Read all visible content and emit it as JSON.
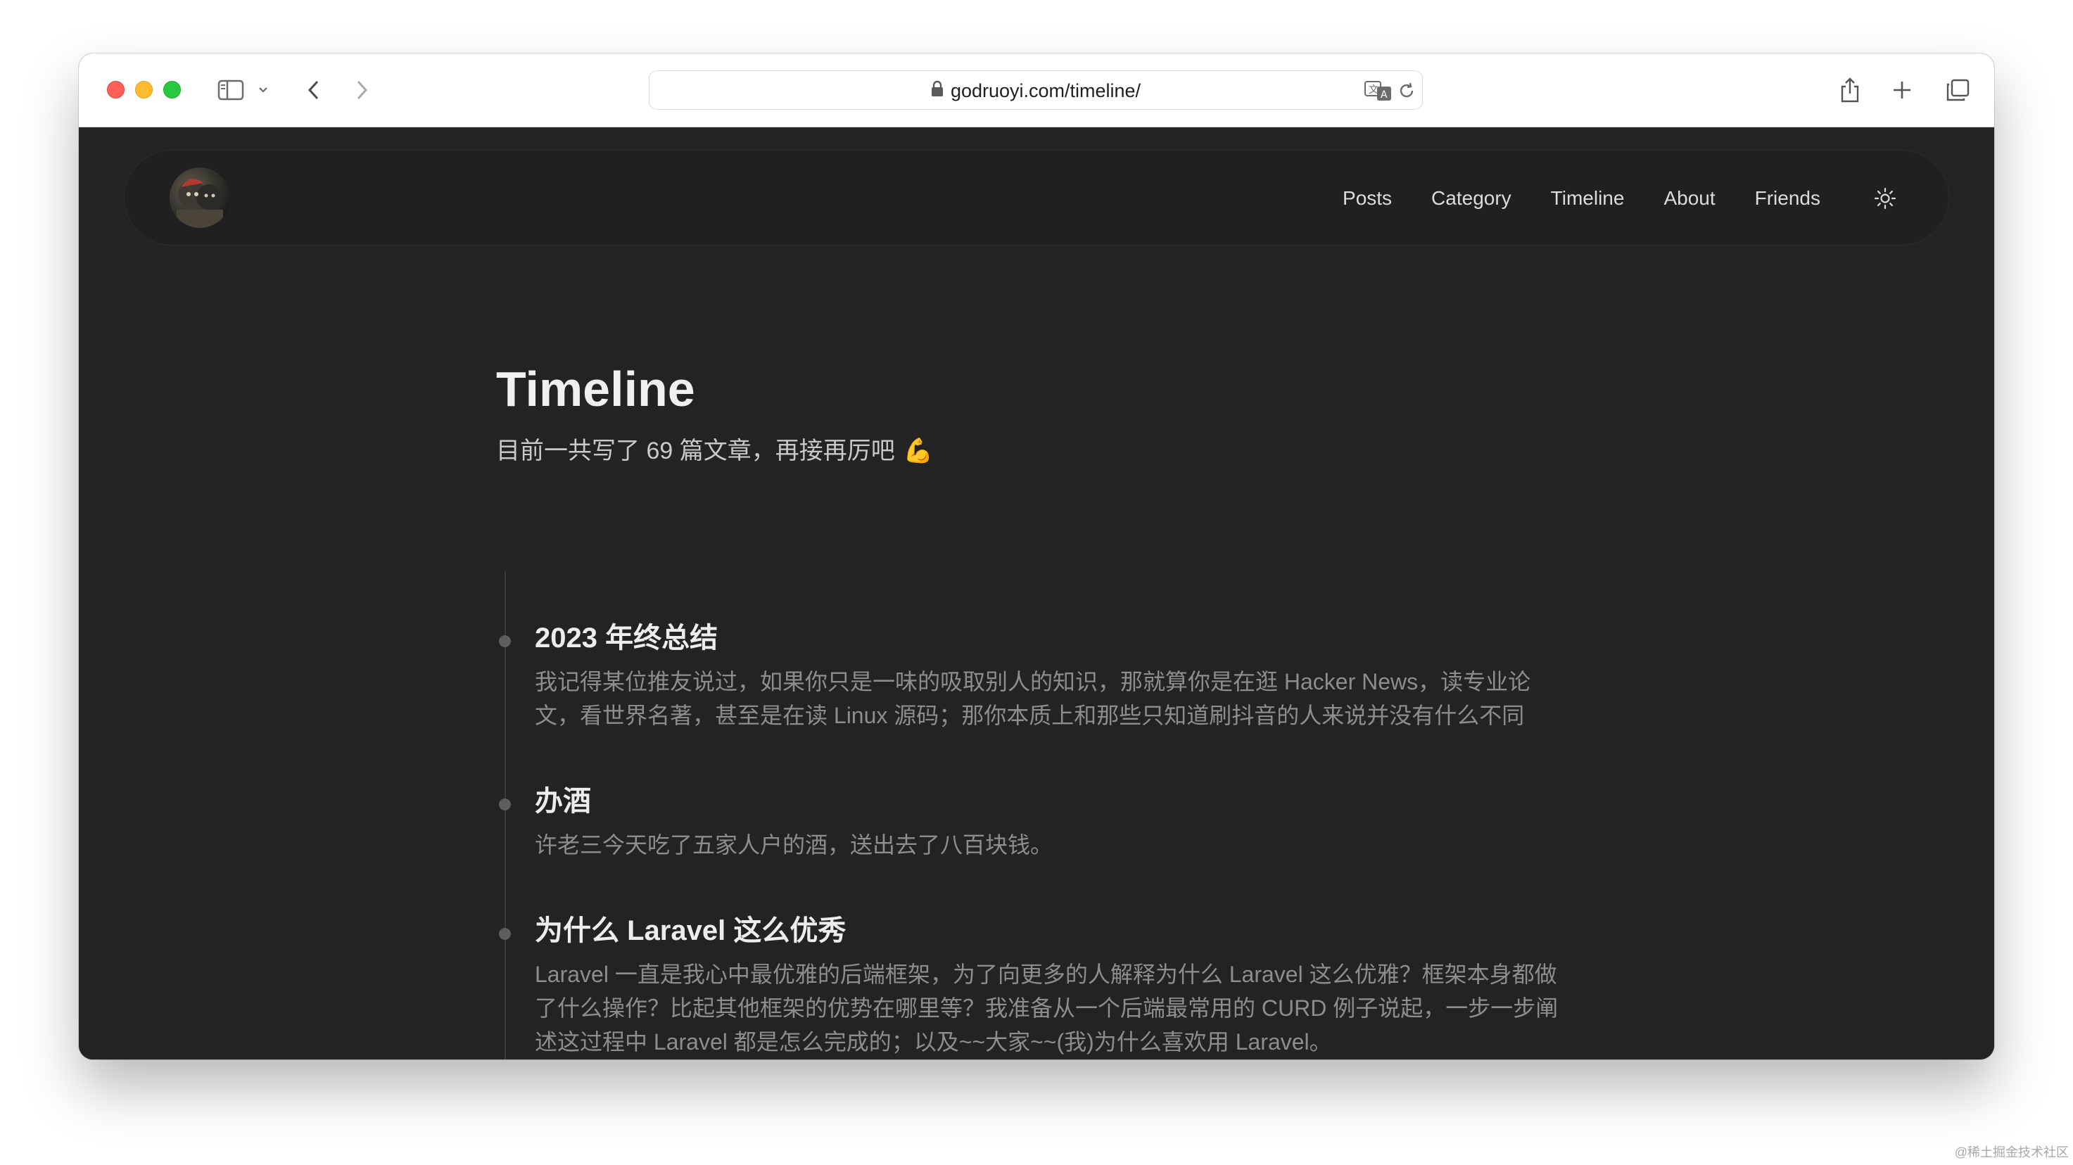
{
  "browser": {
    "url": "godruoyi.com/timeline/",
    "icons": {
      "sidebar": "sidebar-icon",
      "chevron": "chevron-down-icon",
      "back": "back-arrow-icon",
      "forward": "forward-arrow-icon",
      "lock": "lock-icon",
      "translate": "translate-icon",
      "reload": "reload-icon",
      "share": "share-icon",
      "new_tab": "plus-icon",
      "tabs": "tab-overview-icon"
    }
  },
  "nav": {
    "links": [
      "Posts",
      "Category",
      "Timeline",
      "About",
      "Friends"
    ],
    "theme_icon": "sun-icon"
  },
  "page": {
    "title": "Timeline",
    "subtitle": "目前一共写了 69 篇文章，再接再厉吧",
    "subtitle_emoji": "💪"
  },
  "timeline": [
    {
      "title": "2023 年终总结",
      "desc_lines": [
        "我记得某位推友说过，如果你只是一味的吸取别人的知识，那就算你是在逛 Hacker News，读专业论",
        "文，看世界名著，甚至是在读 Linux 源码；那你本质上和那些只知道刷抖音的人来说并没有什么不同"
      ]
    },
    {
      "title": "办酒",
      "desc_lines": [
        "许老三今天吃了五家人户的酒，送出去了八百块钱。"
      ]
    },
    {
      "title": "为什么 Laravel 这么优秀",
      "desc_lines": [
        "Laravel 一直是我心中最优雅的后端框架，为了向更多的人解释为什么 Laravel 这么优雅？框架本身都做",
        "了什么操作？比起其他框架的优势在哪里等？我准备从一个后端最常用的 CURD 例子说起，一步一步阐",
        "述这过程中 Laravel 都是怎么完成的；以及~~大家~~(我)为什么喜欢用 Laravel。"
      ]
    }
  ],
  "colors": {
    "page_bg": "#232323",
    "text_primary": "#efefef",
    "text_muted": "#8d8d8d"
  },
  "watermark": "@稀土掘金技术社区"
}
